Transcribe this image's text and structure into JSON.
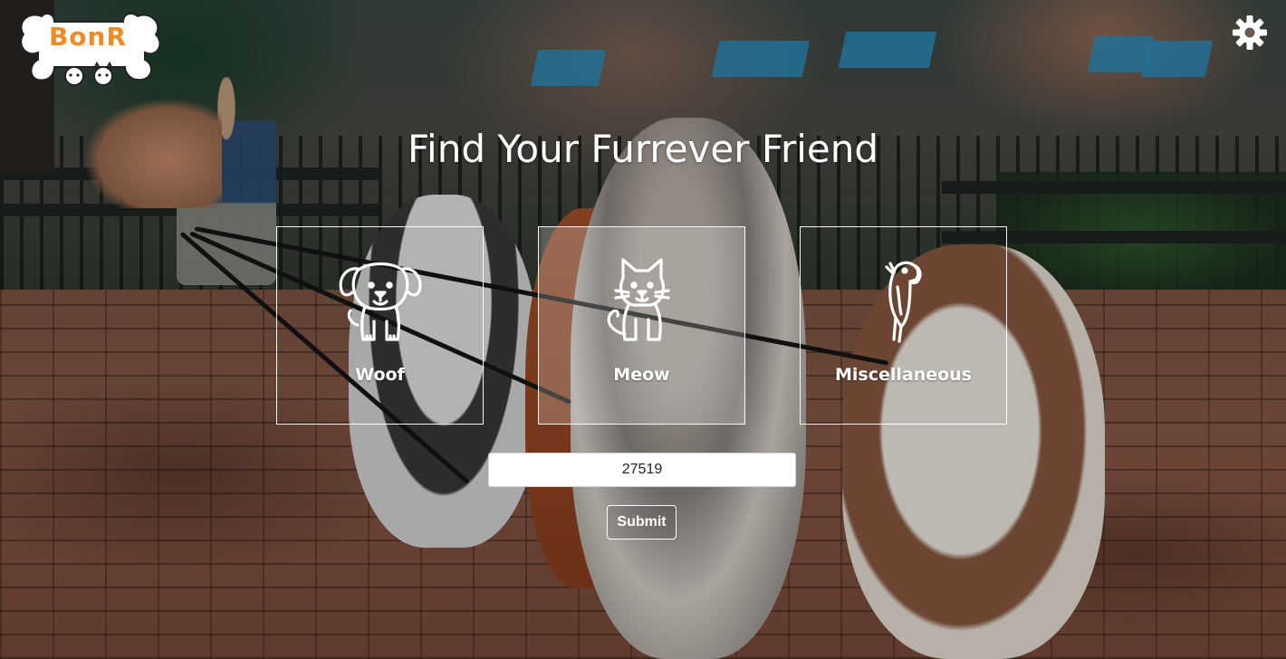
{
  "brand": {
    "logo_text": "BonR",
    "logo_color": "#f08a24"
  },
  "header": {
    "settings_icon": "gear-icon"
  },
  "hero": {
    "title": "Find Your Furrever Friend"
  },
  "categories": [
    {
      "label": "Woof",
      "icon": "dog-icon"
    },
    {
      "label": "Meow",
      "icon": "cat-icon"
    },
    {
      "label": "Miscellaneous",
      "icon": "parrot-icon"
    }
  ],
  "search": {
    "zip_value": "27519",
    "submit_label": "Submit"
  }
}
